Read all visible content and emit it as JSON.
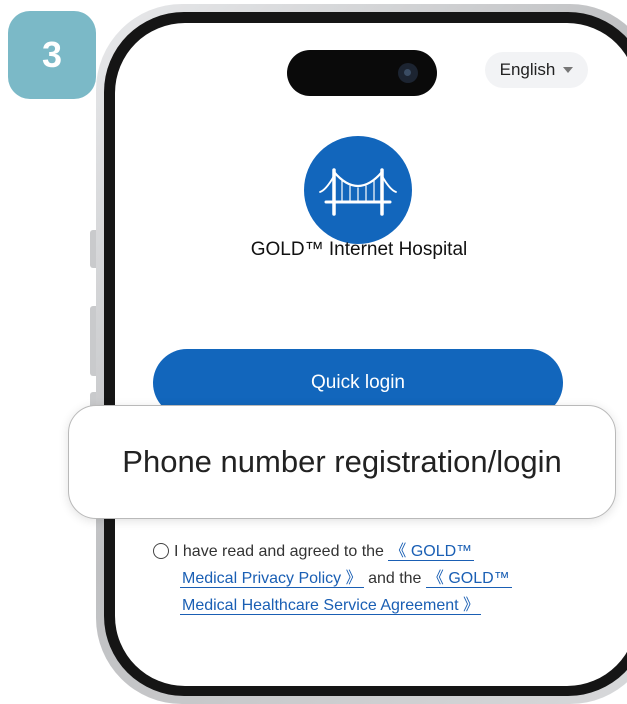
{
  "step_badge": {
    "number": "3"
  },
  "status_bar": {
    "language_label": "English"
  },
  "app": {
    "name": "GOLD™ Internet Hospital"
  },
  "buttons": {
    "quick_login": "Quick login",
    "phone_registration": "Phone number registration/login"
  },
  "agreement": {
    "prefix": "I have read and agreed to the",
    "privacy_part1": "《 GOLD™",
    "privacy_part2": "Medical Privacy Policy 》",
    "connector": "and the",
    "service_part1": "《 GOLD™",
    "service_part2": "Medical Healthcare Service Agreement 》"
  },
  "colors": {
    "brand_blue": "#1266bc",
    "badge_teal": "#7bb9c7",
    "link_blue": "#1a5fb4"
  },
  "icons": {
    "logo": "bridge-icon",
    "language_dropdown": "caret-down-icon"
  }
}
